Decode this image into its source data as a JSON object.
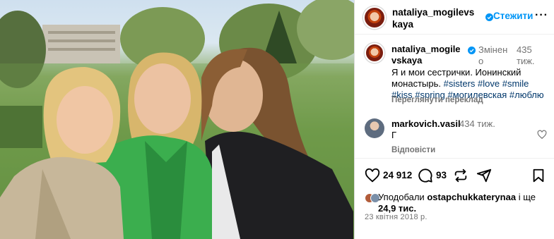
{
  "post": {
    "image_alt": "",
    "author": "nataliya_mogilevskaya",
    "follow_label": "Стежити",
    "more_label": "···"
  },
  "caption": {
    "username": "nataliya_mogilevskaya",
    "edited_label": "Змінено",
    "time": "435 тиж.",
    "text": "Я и мои сестрички. Ионинский монастырь.",
    "hashtags": [
      "#sisters",
      "#love",
      "#smile",
      "#kiss",
      "#spring",
      "#могилевская",
      "#люблю"
    ],
    "translate_label": "Переглянути переклад"
  },
  "comment": {
    "username": "markovich.vasil",
    "time": "434 тиж.",
    "text": "Г",
    "replies_label": "Відповісти"
  },
  "actions": {
    "like_count": "24 912",
    "comment_count": "93"
  },
  "likes": {
    "prefix": "Уподобали",
    "user": "ostapchukkaterynaa",
    "middle": "і ще",
    "count": "24,9 тис."
  },
  "date": "23 квітня 2018 р.",
  "colors": {
    "accent": "#0095f6",
    "hashtag": "#00376b",
    "muted": "#737373"
  }
}
